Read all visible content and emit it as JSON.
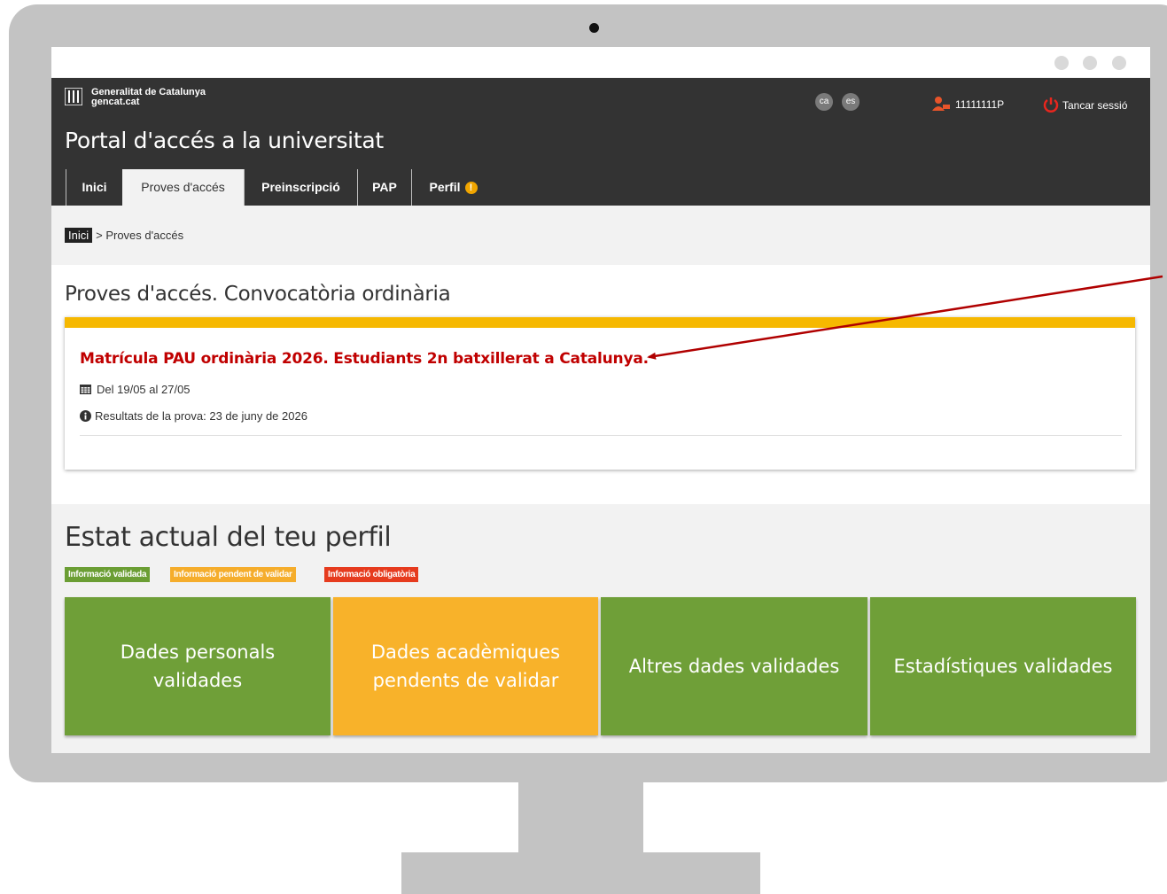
{
  "header": {
    "org_name": "Generalitat de Catalunya",
    "org_domain": "gencat.cat",
    "lang_ca": "ca",
    "lang_es": "es",
    "user_id": "11111111P",
    "logout_label": "Tancar sessió",
    "portal_title": "Portal d'accés a la universitat"
  },
  "tabs": [
    {
      "label": "Inici"
    },
    {
      "label": "Proves d'accés"
    },
    {
      "label": "Preinscripció"
    },
    {
      "label": "PAP"
    },
    {
      "label": "Perfil"
    }
  ],
  "perfil_badge": "!",
  "breadcrumb": {
    "home": "Inici",
    "current": "> Proves d'accés"
  },
  "convocatoria": {
    "title": "Proves d'accés. Convocatòria ordinària",
    "item_title": "Matrícula PAU ordinària 2026. Estudiants 2n batxillerat a Catalunya.",
    "dates": "Del 19/05 al 27/05",
    "results": "Resultats de la prova: 23 de juny de 2026"
  },
  "profile": {
    "title": "Estat actual del teu perfil",
    "legend": [
      {
        "label": "Informació validada",
        "color": "#6b9e34"
      },
      {
        "label": "Informació pendent de validar",
        "color": "#f5ad2c"
      },
      {
        "label": "Informació obligatòria",
        "color": "#e63b1e"
      }
    ],
    "tiles": [
      {
        "label": "Dades personals validades",
        "color": "#6f9f38"
      },
      {
        "label": "Dades acadèmiques pendents de validar",
        "color": "#f8b22a"
      },
      {
        "label": "Altres dades validades",
        "color": "#6f9f38"
      },
      {
        "label": "Estadístiques validades",
        "color": "#6f9f38"
      }
    ]
  },
  "colors": {
    "header_bg": "#333333",
    "accent_bar": "#f6b800",
    "title_red": "#c00000",
    "annotation_arrow": "#b00000"
  }
}
